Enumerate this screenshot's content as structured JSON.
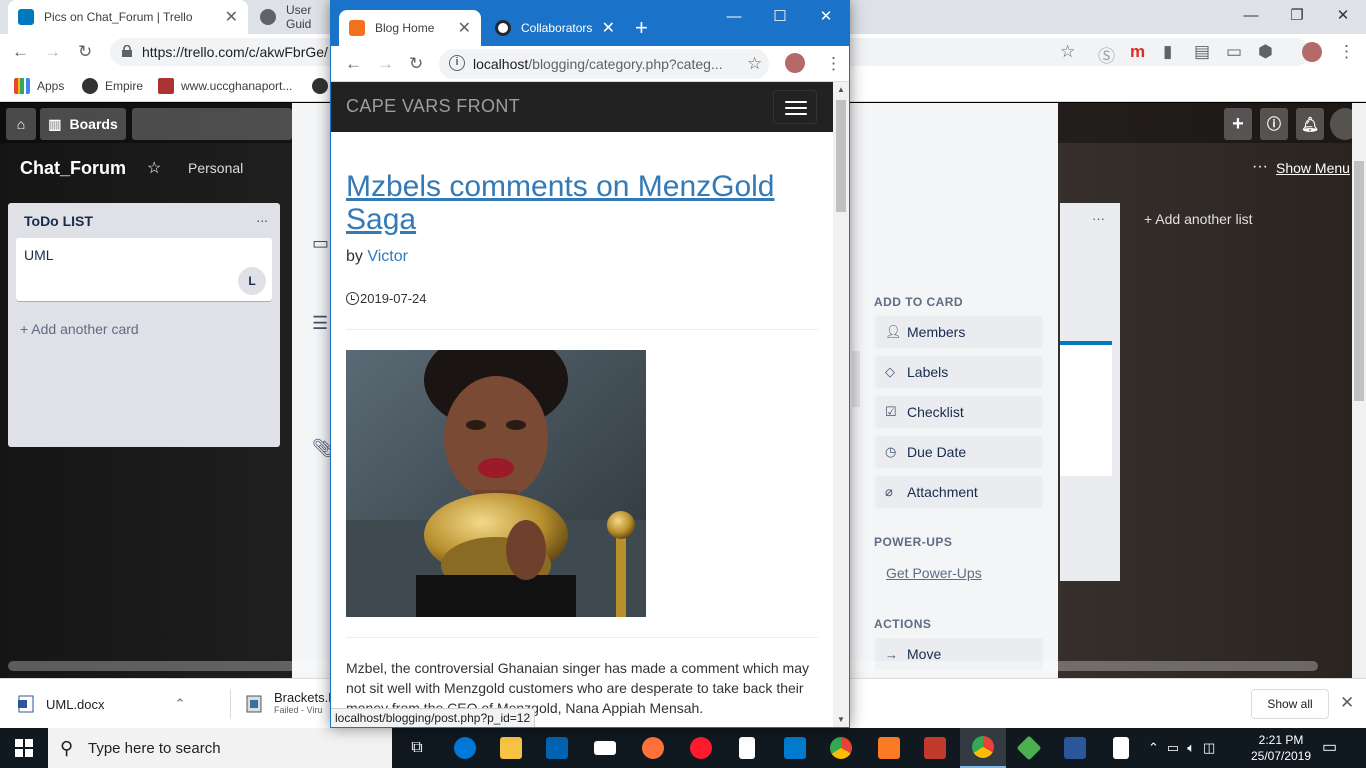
{
  "bg_browser": {
    "tabs": [
      {
        "title": "Pics on Chat_Forum | Trello",
        "favicon_color": "#0079bf"
      },
      {
        "title": "User Guid",
        "favicon_color": "#5f6368"
      }
    ],
    "url": "https://trello.com/c/akwFbrGe/",
    "bookmarks": [
      {
        "label": "Apps"
      },
      {
        "label": "Empire"
      },
      {
        "label": "www.uccghanaport..."
      }
    ]
  },
  "trello": {
    "boards_label": "Boards",
    "board_title": "Chat_Forum",
    "visibility": "Personal",
    "show_menu": "Show Menu",
    "list": {
      "title": "ToDo LIST",
      "menu": "...",
      "card_title": "UML",
      "card_member": "L",
      "add_card": "+ Add another card"
    },
    "add_another_list": "+ Add another list",
    "card_sidebar": {
      "add_to_card_heading": "ADD TO CARD",
      "add_buttons": [
        {
          "label": "Members",
          "icon": "person-icon"
        },
        {
          "label": "Labels",
          "icon": "tag-icon"
        },
        {
          "label": "Checklist",
          "icon": "checklist-icon"
        },
        {
          "label": "Due Date",
          "icon": "clock-icon"
        },
        {
          "label": "Attachment",
          "icon": "paperclip-icon"
        }
      ],
      "powerups_heading": "POWER-UPS",
      "get_powerups": "Get Power-Ups",
      "actions_heading": "ACTIONS",
      "move": "Move"
    }
  },
  "fg_browser": {
    "tabs": [
      {
        "title": "Blog Home",
        "favicon_color": "#f2711c"
      },
      {
        "title": "Collaborators",
        "favicon_color": "#24292e"
      }
    ],
    "url_host": "localhost",
    "url_path": "/blogging/category.php?categ...",
    "status_url": "localhost/blogging/post.php?p_id=12"
  },
  "blog": {
    "brand": "CAPE VARS FRONT",
    "post": {
      "title": "Mzbels comments on MenzGold Saga",
      "by_label": "by",
      "author": "Victor",
      "date": "2019-07-24",
      "excerpt": "Mzbel, the controversial Ghanaian singer has made a comment which may not sit well with Menzgold customers who are desperate to take back their money from the CEO of Menzgold, Nana Appiah Mensah."
    }
  },
  "downloads": [
    {
      "name": "UML.docx",
      "status": ""
    },
    {
      "name": "Brackets.R",
      "status": "Failed - Viru"
    }
  ],
  "downloads_show_all": "Show all",
  "taskbar": {
    "search_placeholder": "Type here to search",
    "time": "2:21 PM",
    "date": "25/07/2019"
  }
}
